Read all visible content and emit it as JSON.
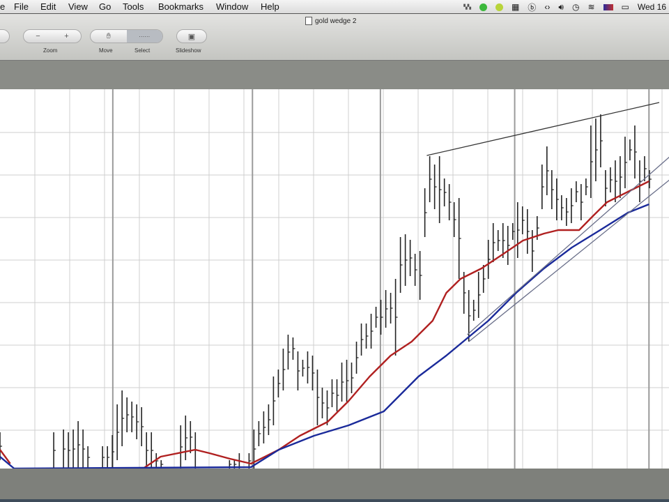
{
  "menubar": {
    "app_fragment": "e",
    "items": [
      "File",
      "Edit",
      "View",
      "Go",
      "Tools",
      "Bookmarks",
      "Window",
      "Help"
    ],
    "clock": "Wed 16"
  },
  "window": {
    "title": "gold wedge 2"
  },
  "toolbar": {
    "zoom_label": "Zoom",
    "zoom_out": "−",
    "zoom_in": "+",
    "move_label": "Move",
    "select_label": "Select",
    "slideshow_label": "Slideshow"
  },
  "chart_data": {
    "type": "ohlc-bars",
    "title": "",
    "xlabel": "",
    "ylabel": "",
    "x_unit": "bar index",
    "y_unit": "relative price",
    "xlim": [
      0,
      137
    ],
    "ylim": [
      0,
      136
    ],
    "grid": true,
    "bars": [
      [
        0,
        13,
        3
      ],
      [
        11,
        13,
        0
      ],
      [
        13,
        14,
        0
      ],
      [
        14,
        13,
        0
      ],
      [
        15,
        14,
        0
      ],
      [
        16,
        17,
        0
      ],
      [
        17,
        14,
        0
      ],
      [
        18,
        8,
        0
      ],
      [
        21,
        8,
        0
      ],
      [
        22,
        8,
        0
      ],
      [
        23,
        12,
        0
      ],
      [
        24,
        23,
        3
      ],
      [
        25,
        28,
        8
      ],
      [
        26,
        25.5,
        13
      ],
      [
        27,
        24,
        13
      ],
      [
        28,
        23,
        10.5
      ],
      [
        29,
        22,
        8
      ],
      [
        30,
        13,
        0
      ],
      [
        31,
        13,
        0
      ],
      [
        32,
        5.5,
        0
      ],
      [
        33,
        3,
        0
      ],
      [
        37,
        15.5,
        0
      ],
      [
        38,
        19,
        3
      ],
      [
        39,
        17,
        5.5
      ],
      [
        40,
        13,
        0
      ],
      [
        47,
        3,
        0
      ],
      [
        48,
        3,
        0
      ],
      [
        49,
        5.5,
        0
      ],
      [
        51,
        5.5,
        0
      ],
      [
        52,
        14,
        0
      ],
      [
        53,
        17,
        8
      ],
      [
        54,
        20.5,
        9
      ],
      [
        55,
        23,
        12
      ],
      [
        56,
        33,
        15.5
      ],
      [
        57,
        35.5,
        25.5
      ],
      [
        58,
        43,
        28
      ],
      [
        59,
        48,
        35.5
      ],
      [
        60,
        47,
        39
      ],
      [
        61,
        42,
        28
      ],
      [
        62,
        39,
        33
      ],
      [
        63,
        42,
        30.5
      ],
      [
        64,
        40.5,
        28
      ],
      [
        65,
        35.5,
        15.5
      ],
      [
        66,
        29,
        18
      ],
      [
        67,
        28,
        15.5
      ],
      [
        68,
        32,
        22
      ],
      [
        69,
        32,
        20.5
      ],
      [
        70,
        38,
        24
      ],
      [
        71,
        39,
        24
      ],
      [
        72,
        38,
        27
      ],
      [
        73,
        45.5,
        34
      ],
      [
        74,
        52,
        40.5
      ],
      [
        75,
        52,
        43
      ],
      [
        76,
        55.5,
        43
      ],
      [
        77,
        58,
        50.5
      ],
      [
        78,
        60.5,
        48
      ],
      [
        79,
        64,
        50.5
      ],
      [
        80,
        63,
        52
      ],
      [
        81,
        68,
        40.5
      ],
      [
        82,
        83,
        63
      ],
      [
        83,
        84,
        65.5
      ],
      [
        84,
        82,
        69
      ],
      [
        85,
        77,
        65.5
      ],
      [
        86,
        78,
        60.5
      ],
      [
        87,
        100.5,
        83
      ],
      [
        88,
        112,
        95.5
      ],
      [
        89,
        109,
        93
      ],
      [
        90,
        112,
        88
      ],
      [
        91,
        104,
        94
      ],
      [
        92,
        102,
        89
      ],
      [
        93,
        95.5,
        83
      ],
      [
        94,
        97,
        68
      ],
      [
        95,
        70.5,
        55.5
      ],
      [
        96,
        64,
        45.5
      ],
      [
        97,
        60.5,
        53
      ],
      [
        98,
        70.5,
        54
      ],
      [
        99,
        73,
        63
      ],
      [
        100,
        82,
        68
      ],
      [
        101,
        88,
        74
      ],
      [
        102,
        85.5,
        78
      ],
      [
        103,
        88,
        75.5
      ],
      [
        104,
        87,
        73
      ],
      [
        105,
        88,
        82
      ],
      [
        106,
        95.5,
        75.5
      ],
      [
        107,
        94,
        84
      ],
      [
        108,
        93,
        77
      ],
      [
        109,
        85.5,
        70.5
      ],
      [
        110,
        90.5,
        82
      ],
      [
        111,
        109,
        93
      ],
      [
        112,
        115.5,
        98
      ],
      [
        113,
        107,
        93
      ],
      [
        114,
        104,
        89
      ],
      [
        115,
        98,
        89
      ],
      [
        116,
        97,
        87
      ],
      [
        117,
        100.5,
        88
      ],
      [
        118,
        103,
        95.5
      ],
      [
        119,
        102,
        89
      ],
      [
        120,
        104,
        98
      ],
      [
        121,
        123,
        97
      ],
      [
        122,
        125.5,
        103
      ],
      [
        123,
        127,
        108
      ],
      [
        124,
        107,
        94
      ],
      [
        125,
        108,
        99
      ],
      [
        126,
        110.5,
        95.5
      ],
      [
        127,
        112,
        97
      ],
      [
        128,
        119,
        100.5
      ],
      [
        129,
        118,
        110.5
      ],
      [
        130,
        123,
        104
      ],
      [
        131,
        110.5,
        95.5
      ],
      [
        132,
        112,
        103
      ],
      [
        133,
        107,
        100.5
      ]
    ],
    "series": [
      {
        "name": "red moving average",
        "color": "#b02020",
        "points": [
          [
            0,
            6.75
          ],
          [
            2.1,
            1.75
          ]
        ]
      },
      {
        "name": "red moving average",
        "color": "#b02020",
        "points": [
          [
            29.3,
            0
          ],
          [
            32.9,
            4.25
          ],
          [
            40,
            6.75
          ],
          [
            42.9,
            5.5
          ],
          [
            47.1,
            3.5
          ],
          [
            51.4,
            1.75
          ],
          [
            57.1,
            6.75
          ],
          [
            61.4,
            11.75
          ],
          [
            67.1,
            16.75
          ],
          [
            71.4,
            24.25
          ],
          [
            75.7,
            33
          ],
          [
            80,
            40.5
          ],
          [
            84.3,
            45.5
          ],
          [
            88.6,
            53
          ],
          [
            91.4,
            63
          ],
          [
            94.3,
            68
          ],
          [
            98.6,
            71.75
          ],
          [
            102.9,
            76.75
          ],
          [
            107.1,
            81.75
          ],
          [
            111.4,
            84.25
          ],
          [
            114.3,
            85.5
          ],
          [
            118.6,
            85.5
          ],
          [
            121.4,
            90.5
          ],
          [
            124.3,
            95.5
          ],
          [
            128.6,
            99.25
          ],
          [
            132.9,
            103
          ]
        ]
      },
      {
        "name": "blue moving average",
        "color": "#1a2a9a",
        "points": [
          [
            0,
            4.25
          ],
          [
            2.9,
            0
          ],
          [
            51.4,
            0.5
          ],
          [
            57.1,
            6.75
          ],
          [
            64.3,
            11.75
          ],
          [
            71.4,
            15.5
          ],
          [
            78.6,
            20.5
          ],
          [
            85.7,
            33
          ],
          [
            91.4,
            40.5
          ],
          [
            95.7,
            46.75
          ],
          [
            100,
            53
          ],
          [
            105.7,
            63
          ],
          [
            111.4,
            71.75
          ],
          [
            117.1,
            79.25
          ],
          [
            122.9,
            85.5
          ],
          [
            128.6,
            91.75
          ],
          [
            132.9,
            94.75
          ]
        ]
      }
    ],
    "trendlines": [
      {
        "name": "upper wedge line",
        "color": "#333333",
        "points": [
          [
            87.4,
            112.25
          ],
          [
            135,
            131.25
          ]
        ]
      },
      {
        "name": "lower wedge line",
        "color": "#6a6f8a",
        "points": [
          [
            96,
            45.5
          ],
          [
            137.1,
            103.5
          ]
        ]
      },
      {
        "name": "lower wedge line 2",
        "color": "#6a6f8a",
        "points": [
          [
            95.7,
            48
          ],
          [
            137.1,
            111.75
          ]
        ]
      }
    ],
    "major_gridlines_x": [
      23.1,
      51.7,
      77.9,
      105.4,
      132.9
    ],
    "colors": {
      "bars": "#222222",
      "grid": "#cfcfcf",
      "major_grid": "#9a9a9a"
    }
  }
}
